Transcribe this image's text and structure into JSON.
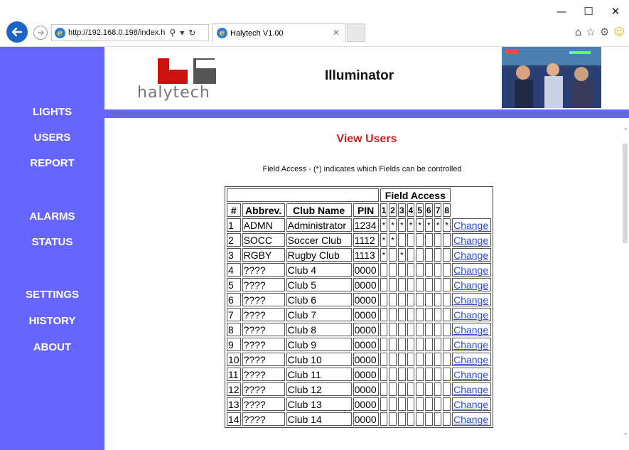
{
  "browser": {
    "address": "http://192.168.0.198/index.h",
    "tab_title": "Halytech V1.00",
    "window_controls": {
      "minimize": "—",
      "maximize": "☐",
      "close": "✕"
    }
  },
  "header": {
    "logo_text": "halytech",
    "title": "Illuminator"
  },
  "sidebar": {
    "items": [
      "LIGHTS",
      "USERS",
      "REPORT",
      "ALARMS",
      "STATUS",
      "SETTINGS",
      "HISTORY",
      "ABOUT"
    ]
  },
  "main": {
    "title": "View Users",
    "note": "Field Access - (*) indicates which Fields can be controlled",
    "table": {
      "group_header": "Field Access",
      "headers": [
        "#",
        "Abbrev.",
        "Club Name",
        "PIN",
        "1",
        "2",
        "3",
        "4",
        "5",
        "6",
        "7",
        "8"
      ],
      "action_label": "Change",
      "rows": [
        {
          "num": "1",
          "abbrev": "ADMN",
          "name": "Administrator",
          "pin": "1234",
          "fields": [
            "*",
            "*",
            "*",
            "*",
            "*",
            "*",
            "*",
            "*"
          ]
        },
        {
          "num": "2",
          "abbrev": "SOCC",
          "name": "Soccer Club",
          "pin": "1112",
          "fields": [
            "*",
            "*",
            "",
            "",
            "",
            "",
            "",
            ""
          ]
        },
        {
          "num": "3",
          "abbrev": "RGBY",
          "name": "Rugby Club",
          "pin": "1113",
          "fields": [
            "*",
            "",
            "*",
            "",
            "",
            "",
            "",
            ""
          ]
        },
        {
          "num": "4",
          "abbrev": "????",
          "name": "Club 4",
          "pin": "0000",
          "fields": [
            "",
            "",
            "",
            "",
            "",
            "",
            "",
            ""
          ]
        },
        {
          "num": "5",
          "abbrev": "????",
          "name": "Club 5",
          "pin": "0000",
          "fields": [
            "",
            "",
            "",
            "",
            "",
            "",
            "",
            ""
          ]
        },
        {
          "num": "6",
          "abbrev": "????",
          "name": "Club 6",
          "pin": "0000",
          "fields": [
            "",
            "",
            "",
            "",
            "",
            "",
            "",
            ""
          ]
        },
        {
          "num": "7",
          "abbrev": "????",
          "name": "Club 7",
          "pin": "0000",
          "fields": [
            "",
            "",
            "",
            "",
            "",
            "",
            "",
            ""
          ]
        },
        {
          "num": "8",
          "abbrev": "????",
          "name": "Club 8",
          "pin": "0000",
          "fields": [
            "",
            "",
            "",
            "",
            "",
            "",
            "",
            ""
          ]
        },
        {
          "num": "9",
          "abbrev": "????",
          "name": "Club 9",
          "pin": "0000",
          "fields": [
            "",
            "",
            "",
            "",
            "",
            "",
            "",
            ""
          ]
        },
        {
          "num": "10",
          "abbrev": "????",
          "name": "Club 10",
          "pin": "0000",
          "fields": [
            "",
            "",
            "",
            "",
            "",
            "",
            "",
            ""
          ]
        },
        {
          "num": "11",
          "abbrev": "????",
          "name": "Club 11",
          "pin": "0000",
          "fields": [
            "",
            "",
            "",
            "",
            "",
            "",
            "",
            ""
          ]
        },
        {
          "num": "12",
          "abbrev": "????",
          "name": "Club 12",
          "pin": "0000",
          "fields": [
            "",
            "",
            "",
            "",
            "",
            "",
            "",
            ""
          ]
        },
        {
          "num": "13",
          "abbrev": "????",
          "name": "Club 13",
          "pin": "0000",
          "fields": [
            "",
            "",
            "",
            "",
            "",
            "",
            "",
            ""
          ]
        },
        {
          "num": "14",
          "abbrev": "????",
          "name": "Club 14",
          "pin": "0000",
          "fields": [
            "",
            "",
            "",
            "",
            "",
            "",
            "",
            ""
          ]
        }
      ]
    }
  },
  "colors": {
    "sidebar": "#6666ff",
    "title": "#cc2222",
    "link": "#2b4cdc",
    "logo_red": "#cc1111",
    "logo_gray": "#555555"
  }
}
